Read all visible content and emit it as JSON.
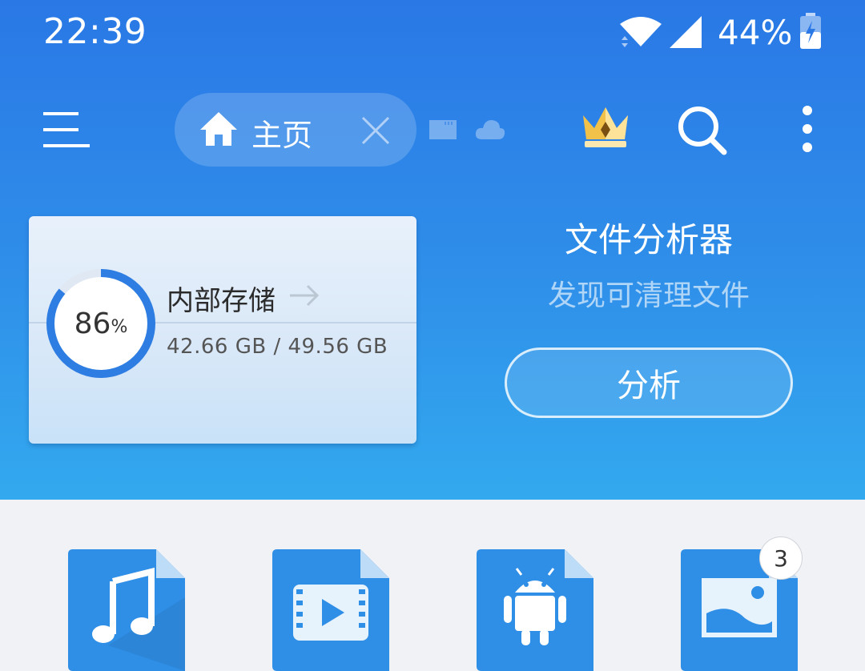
{
  "status_bar": {
    "time": "22:39",
    "battery_percent": "44%",
    "icons": [
      "wifi-icon",
      "signal-icon",
      "battery-charging-icon"
    ]
  },
  "toolbar": {
    "menu_icon": "menu-icon",
    "tab": {
      "icon": "home-icon",
      "label": "主页",
      "close_icon": "close-icon"
    },
    "extra_location_icons": [
      "sd-card-icon",
      "cloud-icon"
    ],
    "actions": [
      "crown-icon",
      "search-icon",
      "more-vert-icon"
    ]
  },
  "storage": {
    "percent_value": "86",
    "percent_sign": "%",
    "used_fraction": 0.86,
    "title": "内部存储",
    "usage": "42.66 GB / 49.56 GB"
  },
  "analyzer": {
    "title": "文件分析器",
    "subtitle": "发现可清理文件",
    "button_label": "分析"
  },
  "categories": [
    {
      "icon": "music-icon"
    },
    {
      "icon": "video-icon"
    },
    {
      "icon": "android-app-icon"
    },
    {
      "icon": "image-icon",
      "badge": "3"
    }
  ],
  "colors": {
    "header_top": "#2a78e6",
    "header_bottom": "#33a9ef",
    "ring": "#2d7de3",
    "tile": "#2f8ee5",
    "page_bg": "#f0f2f5"
  }
}
